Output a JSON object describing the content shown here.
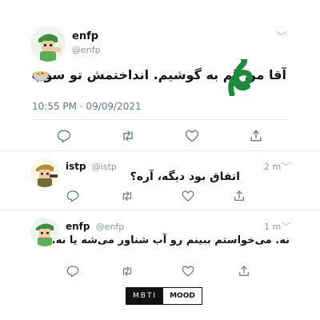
{
  "main_tweet": {
    "name": "enfp",
    "handle": "@enfp",
    "text": "آقا من گم به گوشیم. انداختمش تو سوپ",
    "timestamp": "10:55 PM · 09/09/2021",
    "caret_icon": "chevron-down-icon",
    "avatar_icon": "character-avatar-icon"
  },
  "actions": [
    "reply-icon",
    "retweet-icon",
    "like-icon",
    "share-icon"
  ],
  "replies": [
    {
      "name": "istp",
      "handle": "@istp",
      "time": "2 m",
      "text": "اتفاق بود دیگه، آره؟"
    },
    {
      "name": "enfp",
      "handle": "@enfp",
      "time": "1 m",
      "text": "نه. می‌خواستم ببینم رو آب شناور می‌شه یا نه."
    }
  ],
  "brand": {
    "left": "MBTI",
    "right": "MOOD"
  },
  "colors": {
    "text": "#14171a",
    "muted": "#657786",
    "divider": "#e6ecf0",
    "scribble": "#1f8a3c"
  }
}
